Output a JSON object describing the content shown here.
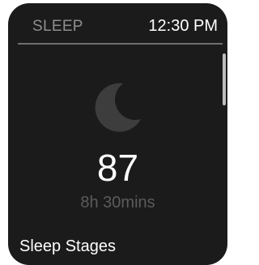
{
  "header": {
    "app_title": "SLEEP",
    "time": "12:30 PM"
  },
  "main": {
    "icon": "moon-icon",
    "score": "87",
    "duration": "8h 30mins"
  },
  "footer": {
    "stages_label": "Sleep Stages"
  },
  "colors": {
    "background": "#1b1b1b",
    "title": "#8e8e8e",
    "muted": "#5b5b5b",
    "moon": "#3d3d3d"
  }
}
